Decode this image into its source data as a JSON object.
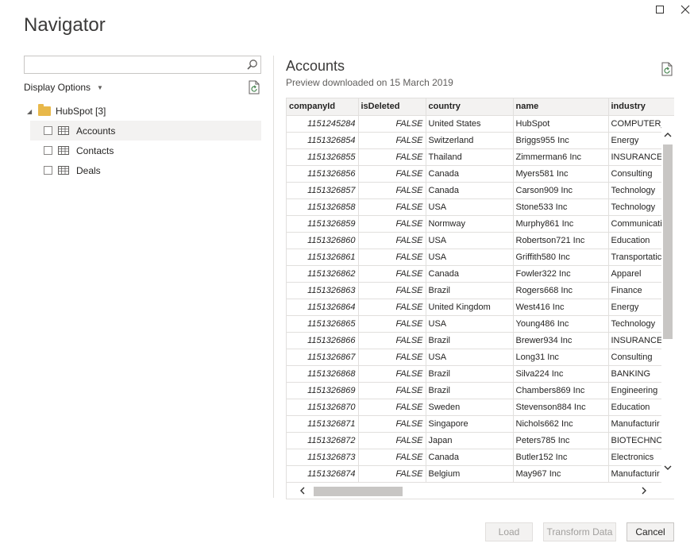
{
  "window": {
    "title": "Navigator"
  },
  "search": {
    "placeholder": "",
    "value": ""
  },
  "display_options": {
    "label": "Display Options"
  },
  "tree": {
    "root": {
      "label": "HubSpot [3]",
      "expanded": true
    },
    "items": [
      {
        "label": "Accounts",
        "checked": false,
        "selected": true
      },
      {
        "label": "Contacts",
        "checked": false,
        "selected": false
      },
      {
        "label": "Deals",
        "checked": false,
        "selected": false
      }
    ]
  },
  "preview": {
    "title": "Accounts",
    "subtitle": "Preview downloaded on 15 March 2019",
    "columns": [
      "companyId",
      "isDeleted",
      "country",
      "name",
      "industry"
    ],
    "rows": [
      [
        "1151245284",
        "FALSE",
        "United States",
        "HubSpot",
        "COMPUTER_S"
      ],
      [
        "1151326854",
        "FALSE",
        "Switzerland",
        "Briggs955 Inc",
        "Energy"
      ],
      [
        "1151326855",
        "FALSE",
        "Thailand",
        "Zimmerman6 Inc",
        "INSURANCE"
      ],
      [
        "1151326856",
        "FALSE",
        "Canada",
        "Myers581 Inc",
        "Consulting"
      ],
      [
        "1151326857",
        "FALSE",
        "Canada",
        "Carson909 Inc",
        "Technology"
      ],
      [
        "1151326858",
        "FALSE",
        "USA",
        "Stone533 Inc",
        "Technology"
      ],
      [
        "1151326859",
        "FALSE",
        "Normway",
        "Murphy861 Inc",
        "Communicati"
      ],
      [
        "1151326860",
        "FALSE",
        "USA",
        "Robertson721 Inc",
        "Education"
      ],
      [
        "1151326861",
        "FALSE",
        "USA",
        "Griffith580 Inc",
        "Transportatic"
      ],
      [
        "1151326862",
        "FALSE",
        "Canada",
        "Fowler322 Inc",
        "Apparel"
      ],
      [
        "1151326863",
        "FALSE",
        "Brazil",
        "Rogers668 Inc",
        "Finance"
      ],
      [
        "1151326864",
        "FALSE",
        "United Kingdom",
        "West416 Inc",
        "Energy"
      ],
      [
        "1151326865",
        "FALSE",
        "USA",
        "Young486 Inc",
        "Technology"
      ],
      [
        "1151326866",
        "FALSE",
        "Brazil",
        "Brewer934 Inc",
        "INSURANCE"
      ],
      [
        "1151326867",
        "FALSE",
        "USA",
        "Long31 Inc",
        "Consulting"
      ],
      [
        "1151326868",
        "FALSE",
        "Brazil",
        "Silva224 Inc",
        "BANKING"
      ],
      [
        "1151326869",
        "FALSE",
        "Brazil",
        "Chambers869 Inc",
        "Engineering"
      ],
      [
        "1151326870",
        "FALSE",
        "Sweden",
        "Stevenson884 Inc",
        "Education"
      ],
      [
        "1151326871",
        "FALSE",
        "Singapore",
        "Nichols662 Inc",
        "Manufacturir"
      ],
      [
        "1151326872",
        "FALSE",
        "Japan",
        "Peters785 Inc",
        "BIOTECHNOL"
      ],
      [
        "1151326873",
        "FALSE",
        "Canada",
        "Butler152 Inc",
        "Electronics"
      ],
      [
        "1151326874",
        "FALSE",
        "Belgium",
        "May967 Inc",
        "Manufacturir"
      ]
    ]
  },
  "buttons": {
    "load": {
      "label": "Load",
      "disabled": true
    },
    "transform": {
      "label": "Transform Data",
      "disabled": true
    },
    "cancel": {
      "label": "Cancel",
      "disabled": false
    }
  },
  "icons": {
    "search": "search-icon",
    "refresh": "refresh-icon",
    "table": "table-icon",
    "folder": "folder-icon",
    "maximize": "maximize-icon",
    "close": "close-icon"
  },
  "colors": {
    "accent_folder": "#e8b84a",
    "header_bg": "#f3f2f1",
    "selected_bg": "#f3f2f1",
    "border": "#e1dfdd"
  }
}
